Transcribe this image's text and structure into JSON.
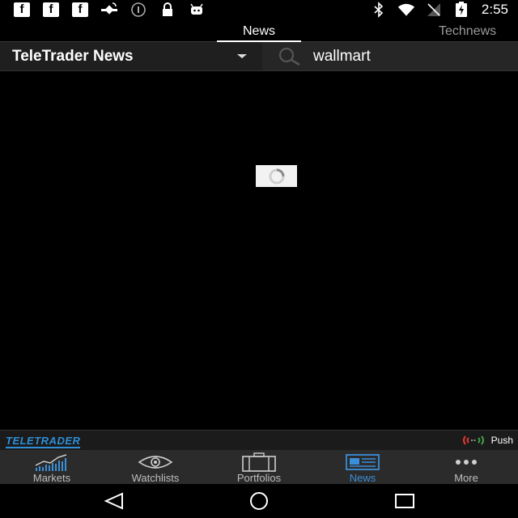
{
  "status_bar": {
    "time": "2:55",
    "left_icons": [
      "facebook-icon",
      "facebook-icon",
      "facebook-icon",
      "satellite-icon",
      "info-icon",
      "lock-icon",
      "android-icon"
    ],
    "right_icons": [
      "bluetooth-icon",
      "wifi-icon",
      "signal-icon",
      "battery-charging-icon"
    ]
  },
  "tabs": [
    {
      "label": "News",
      "active": true
    },
    {
      "label": "Technews",
      "active": false
    }
  ],
  "toolbar": {
    "source_label": "TeleTrader News",
    "search_value": "wallmart"
  },
  "content": {
    "loading": true
  },
  "brand_bar": {
    "logo_text": "TELETRADER",
    "push_label": "Push"
  },
  "bottom_nav": {
    "items": [
      {
        "label": "Markets",
        "icon": "markets-chart-icon",
        "active": false
      },
      {
        "label": "Watchlists",
        "icon": "eye-icon",
        "active": false
      },
      {
        "label": "Portfolios",
        "icon": "briefcase-icon",
        "active": false
      },
      {
        "label": "News",
        "icon": "newspaper-icon",
        "active": true
      },
      {
        "label": "More",
        "icon": "more-dots-icon",
        "active": false
      }
    ]
  },
  "colors": {
    "accent": "#3a8fd9",
    "brand": "#2e8fd8",
    "push_red": "#e53935",
    "push_green": "#43a047"
  }
}
